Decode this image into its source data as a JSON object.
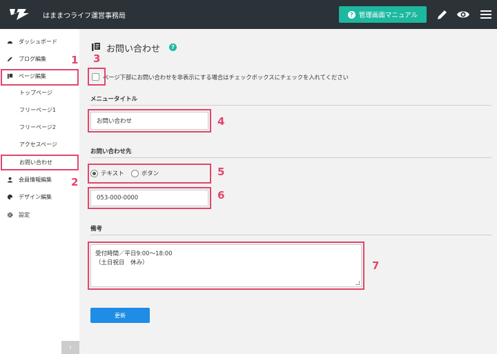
{
  "header": {
    "site_title": "はままつライフ運営事務局",
    "manual_button": "管理画面マニュアル",
    "icons": [
      "logo-icon",
      "pencil-icon",
      "eye-icon",
      "menu-icon"
    ],
    "bg_color": "#2b3238",
    "accent_color": "#1db8a0"
  },
  "sidebar": {
    "items": [
      {
        "label": "ダッシュボード",
        "icon": "dashboard-icon"
      },
      {
        "label": "ブログ編集",
        "icon": "pencil-icon"
      },
      {
        "label": "ページ編集",
        "icon": "pages-icon"
      },
      {
        "label": "トップページ"
      },
      {
        "label": "フリーページ1"
      },
      {
        "label": "フリーページ2"
      },
      {
        "label": "アクセスページ"
      },
      {
        "label": "お問い合わせ"
      },
      {
        "label": "会員情報編集",
        "icon": "user-icon"
      },
      {
        "label": "デザイン編集",
        "icon": "palette-icon"
      },
      {
        "label": "設定",
        "icon": "gear-icon"
      }
    ],
    "collapse": "‹"
  },
  "main": {
    "title": "お問い合わせ",
    "hide_checkbox_label": "ページ下部にお問い合わせを非表示にする場合はチェックボックスにチェックを入れてください",
    "menu_title_label": "メニュータイトル",
    "menu_title_value": "お問い合わせ",
    "contact_label": "お問い合わせ先",
    "radio_text": "テキスト",
    "radio_button": "ボタン",
    "phone_value": "053-000-0000",
    "notes_label": "備考",
    "notes_value": "受付時間／平日9:00〜18:00\n（土日祝日　休み）",
    "update_button": "更新"
  },
  "annotations": {
    "color": "#e0456a",
    "labels": [
      "1",
      "2",
      "3",
      "4",
      "5",
      "6",
      "7"
    ]
  }
}
